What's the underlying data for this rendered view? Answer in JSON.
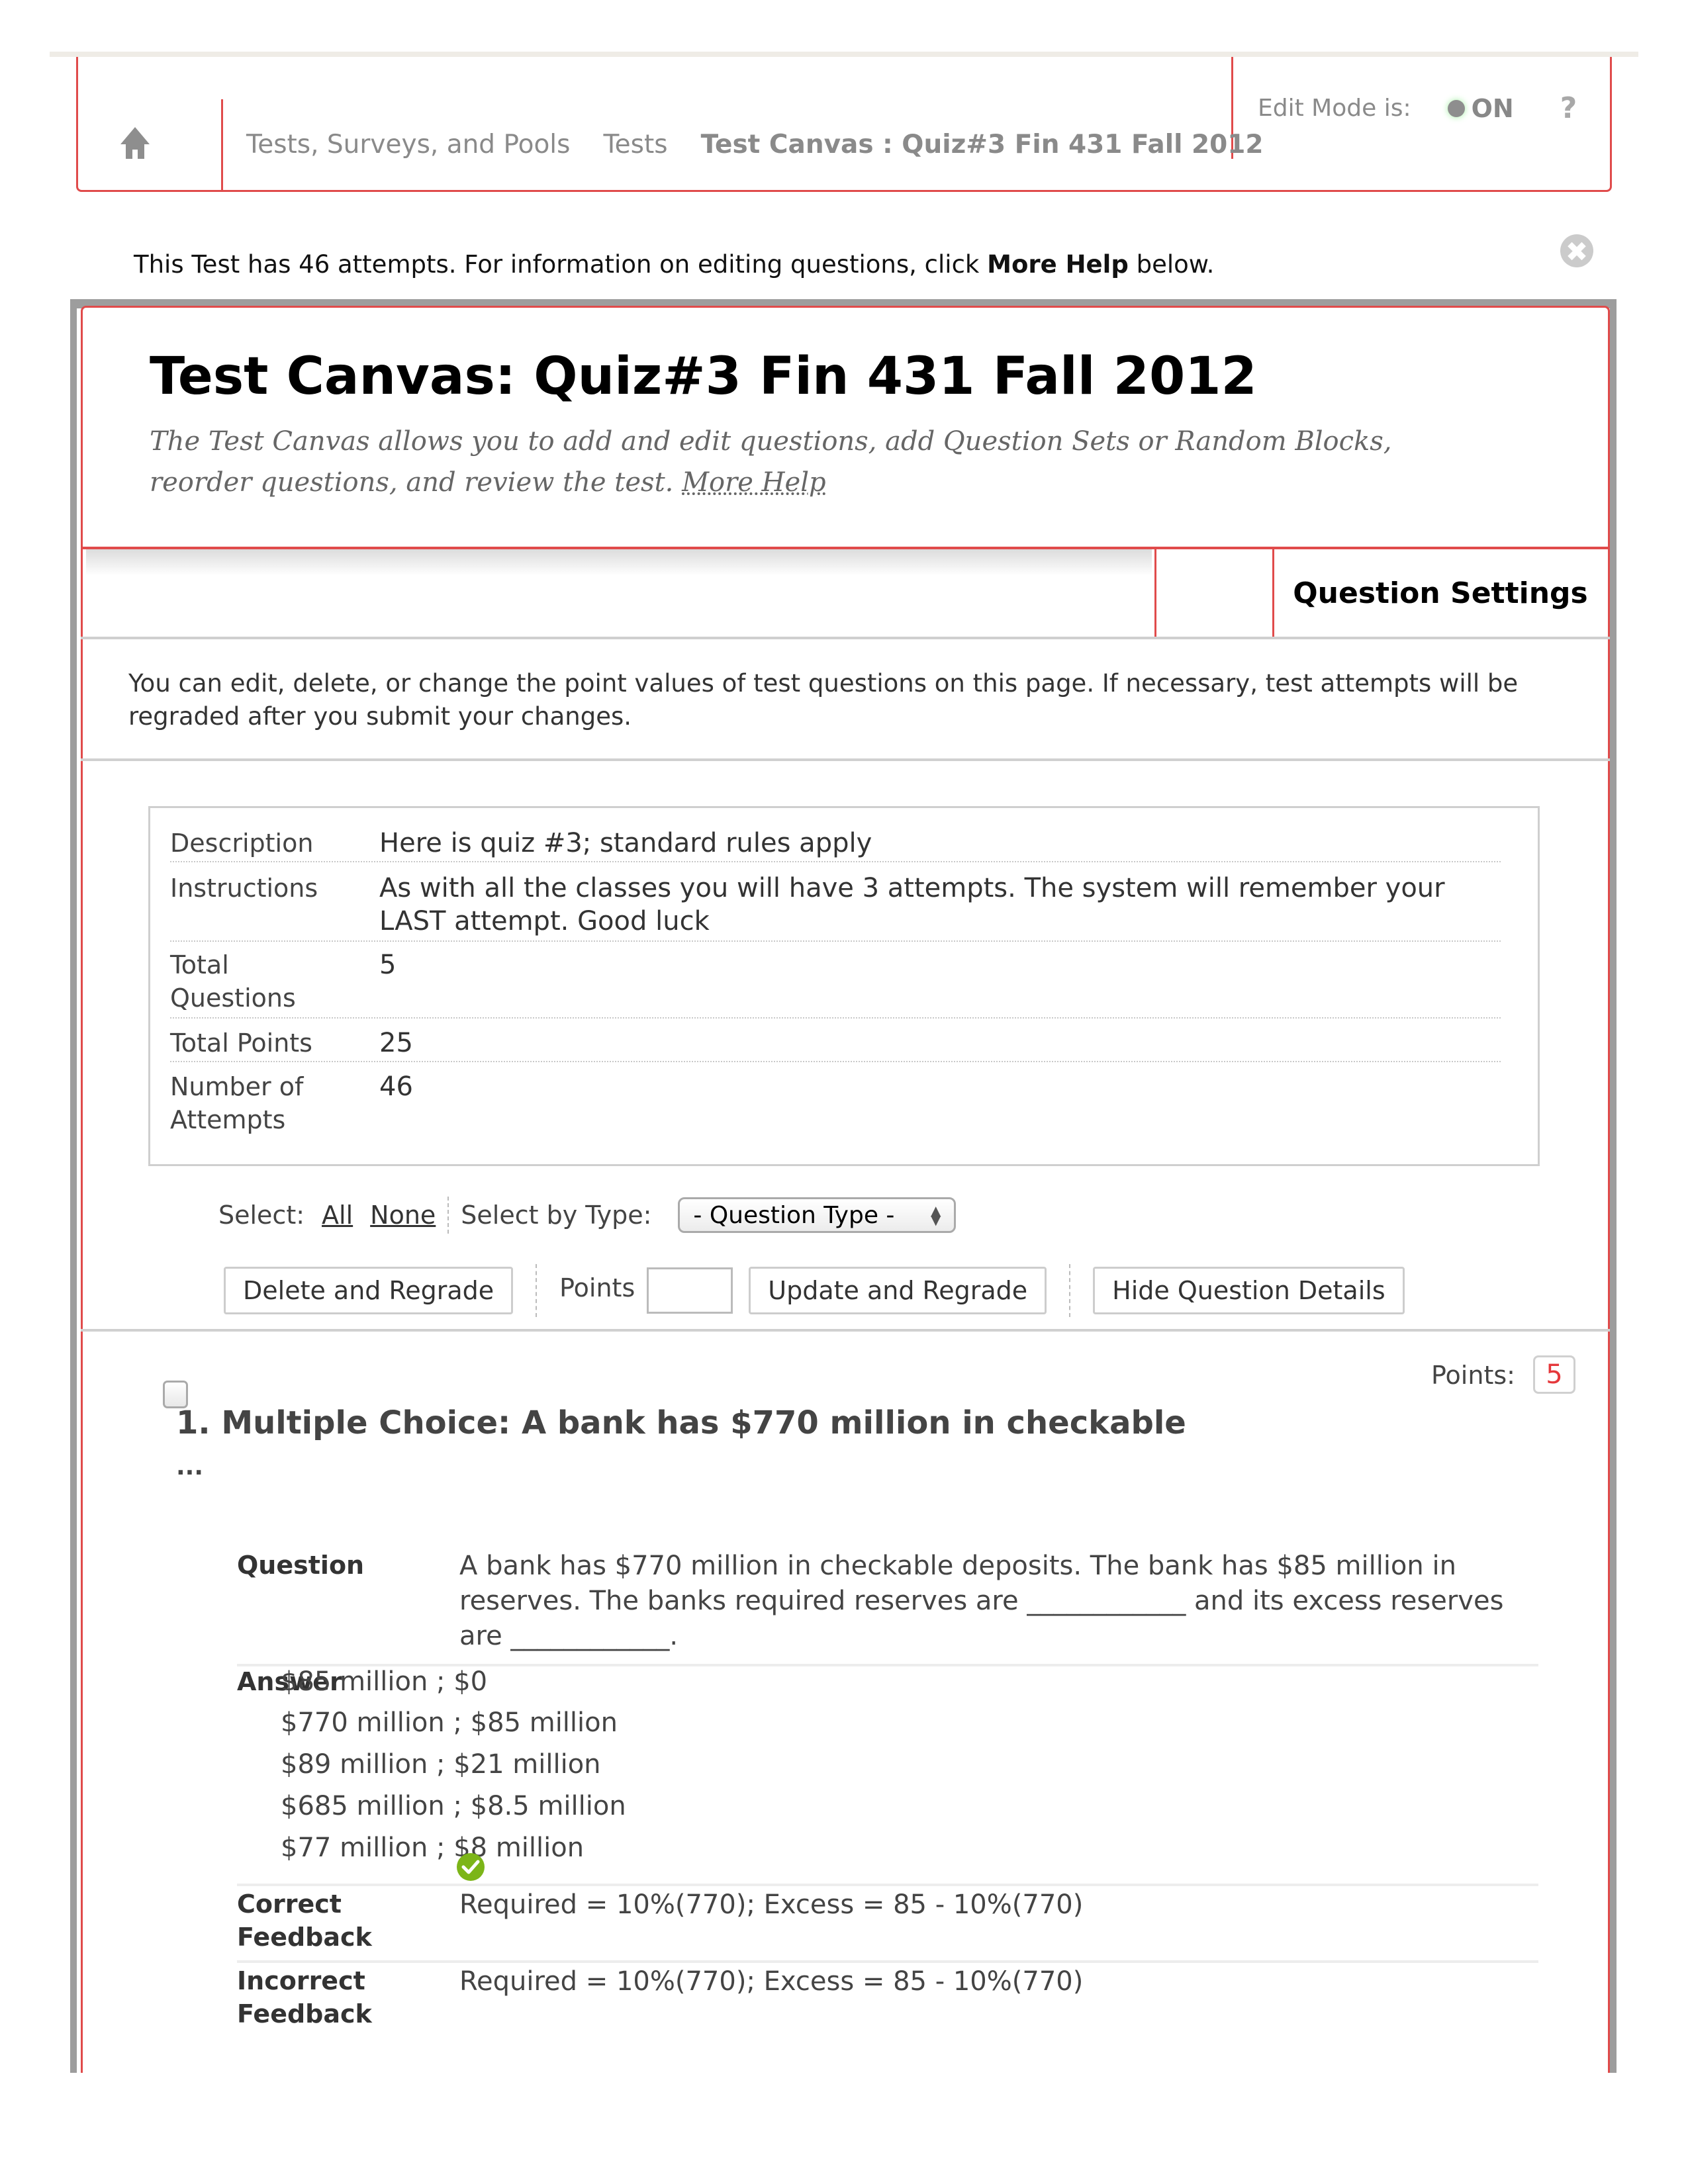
{
  "breadcrumb": {
    "items": [
      "Tests, Surveys, and Pools",
      "Tests"
    ],
    "current": "Test Canvas : Quiz#3 Fin 431 Fall 2012"
  },
  "edit_mode": {
    "label": "Edit Mode is:",
    "state": "ON",
    "help": "?"
  },
  "info_message": {
    "prefix": "This Test has 46 attempts. For information on editing questions, click ",
    "link": "More Help",
    "suffix": " below."
  },
  "page": {
    "title": "Test Canvas: Quiz#3 Fin 431 Fall 2012",
    "subtitle": "The Test Canvas allows you to add and edit questions, add Question Sets or Random Blocks, reorder questions, and review the test. ",
    "subtitle_link": "More Help"
  },
  "tabs": {
    "question_settings": "Question Settings"
  },
  "intro": "You can edit, delete, or change the point values of test questions on this page. If necessary, test attempts will be regraded after you submit your changes.",
  "details": [
    {
      "label": "Description",
      "value": "Here is quiz #3; standard rules apply"
    },
    {
      "label": "Instructions",
      "value": "As with all the classes you will have 3 attempts.  The system will remember your LAST attempt.  Good luck"
    },
    {
      "label": "Total Questions",
      "value": "5"
    },
    {
      "label": "Total Points",
      "value": "25"
    },
    {
      "label": "Number of Attempts",
      "value": "46"
    }
  ],
  "select": {
    "label": "Select:",
    "all": "All",
    "none": "None",
    "by_type_label": "Select by Type:",
    "type_selected": "- Question Type -"
  },
  "buttons": {
    "delete_regrade": "Delete and Regrade",
    "points_label": "Points",
    "points_value": "",
    "update_regrade": "Update and Regrade",
    "hide_details": "Hide Question Details"
  },
  "question": {
    "points_label": "Points:",
    "points": "5",
    "title": "1. Multiple Choice: A bank has $770 million in checkable",
    "ellipsis": "...",
    "question_label": "Question",
    "question_text": "A bank has $770 million in checkable deposits. The bank has $85 million in reserves. The banks required reserves are ____________ and its excess reserves are ____________.",
    "answer_label": "Answer",
    "answers": [
      "$85 million ; $0",
      "$770 million ; $85 million",
      "$89 million ; $21 million",
      "$685 million ; $8.5 million",
      "$77 million ; $8 million"
    ],
    "correct_index": 4,
    "correct_feedback_label": "Correct Feedback",
    "correct_feedback": "Required = 10%(770); Excess = 85 - 10%(770)",
    "incorrect_feedback_label": "Incorrect Feedback",
    "incorrect_feedback": "Required = 10%(770); Excess = 85 - 10%(770)"
  },
  "colors": {
    "accent_red": "#e04b4b",
    "correct_green": "#7cb518",
    "points_red": "#e5383b"
  }
}
